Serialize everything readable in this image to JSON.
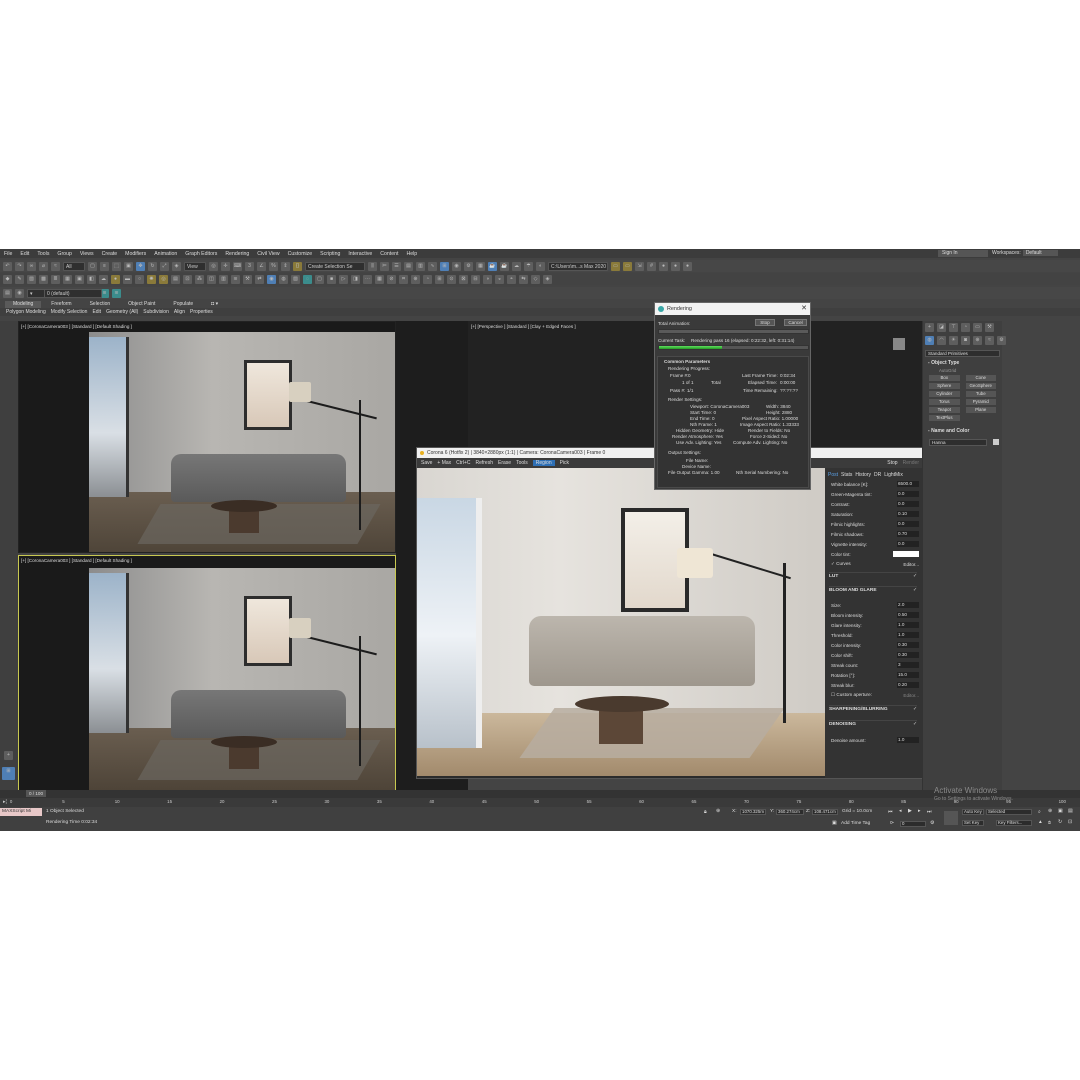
{
  "menu": [
    "File",
    "Edit",
    "Tools",
    "Group",
    "Views",
    "Create",
    "Modifiers",
    "Animation",
    "Graph Editors",
    "Rendering",
    "Civil View",
    "Customize",
    "Scripting",
    "Interactive",
    "Content",
    "Help"
  ],
  "signin": "Sign In",
  "workspace_label": "Workspaces:",
  "workspace_value": "Default",
  "toolbar": {
    "filter": "All",
    "view": "View",
    "selection_set": "Create Selection Se",
    "path": "C:\\Users\\m...s Max 2020"
  },
  "layer_value": "0 (default)",
  "ribbon_tabs": [
    "Modeling",
    "Freeform",
    "Selection",
    "Object Paint",
    "Populate"
  ],
  "ribbon_sub": [
    "Polygon Modeling",
    "Modify Selection",
    "Edit",
    "Geometry (All)",
    "Subdivision",
    "Align",
    "Properties"
  ],
  "viewports": {
    "top_left": "[+] [CoronaCamera003 ] [Standard ] [Default Shading ]",
    "top_right": "[+] [Perspective ] [Standard ] [Clay + Edged Faces ]",
    "bottom_left": "[+] [CoronaCamera003 ] [Standard ] [Default Shading ]"
  },
  "corona": {
    "title": "Corona 6 (Hotfix 2) | 3840×2880px (1:1) | Camera: CoronaCamera003 | Frame 0",
    "tools": [
      "Save",
      "+ Max",
      "Ctrl+C",
      "Refresh",
      "Erase",
      "Tools",
      "Region",
      "Pick"
    ],
    "stop": "Stop",
    "render": "Render",
    "tabs": [
      "Post",
      "Stats",
      "History",
      "DR",
      "LightMix"
    ],
    "rows_top": [
      {
        "label": "White balance [K]:",
        "value": "6500.0"
      },
      {
        "label": "Green-Magenta tint:",
        "value": "0.0"
      },
      {
        "label": "Contrast:",
        "value": "0.0"
      },
      {
        "label": "Saturation:",
        "value": "0.10"
      },
      {
        "label": "Filmic highlights:",
        "value": "0.0"
      },
      {
        "label": "Filmic shadows:",
        "value": "0.70"
      },
      {
        "label": "Vignette intensity:",
        "value": "0.0"
      },
      {
        "label": "Color tint:",
        "value": ""
      }
    ],
    "curves": "Curves",
    "editor": "Editor...",
    "lut": "LUT",
    "bloom": "BLOOM AND GLARE",
    "rows_bloom": [
      {
        "label": "Size:",
        "value": "2.0"
      },
      {
        "label": "Bloom intensity:",
        "value": "0.50"
      },
      {
        "label": "Glare intensity:",
        "value": "1.0"
      },
      {
        "label": "Threshold:",
        "value": "1.0"
      },
      {
        "label": "Color intensity:",
        "value": "0.30"
      },
      {
        "label": "Color shift:",
        "value": "0.30"
      },
      {
        "label": "Streak count:",
        "value": "3"
      },
      {
        "label": "Rotation [°]:",
        "value": "15.0"
      },
      {
        "label": "Streak blur:",
        "value": "0.20"
      }
    ],
    "custom_aperture": "Custom aperture:",
    "editor2": "Editor...",
    "sharpen": "SHARPENING/BLURRING",
    "denoise": "DENOISING",
    "denoise_label": "Denoise amount:",
    "denoise_value": "1.0"
  },
  "rendering": {
    "title": "Rendering",
    "total_animation": "Total Animation:",
    "pause": "Pause",
    "stop": "Stop",
    "cancel": "Cancel",
    "total_progress": 1.0,
    "current_task_label": "Current Task:",
    "current_task": "Rendering pass 16 (elapsed: 0:22:32, left: 0:31:14)",
    "task_progress": 0.42,
    "section": "Common Parameters",
    "progress_label": "Rendering Progress:",
    "frame_label": "Frame #:",
    "frame_value": "0",
    "of_label": "1 of 1",
    "total_label": "Total",
    "pass_label": "Pass #:",
    "pass_value": "1/1",
    "last_frame_label": "Last Frame Time:",
    "last_frame_value": "0:02:34",
    "elapsed_label": "Elapsed Time:",
    "elapsed_value": "0:00:00",
    "remaining_label": "Time Remaining:",
    "remaining_value": "??:??:??",
    "render_settings": "Render Settings:",
    "settings_left": [
      "Viewport: CoronaCamera003",
      "Start Time: 0",
      "End Time: 0",
      "Nth Frame: 1",
      "Hidden Geometry: Hide",
      "Render Atmosphere: Yes",
      "Use Adv. Lighting: Yes"
    ],
    "settings_right": [
      "Width: 3840",
      "Height: 2880",
      "Pixel Aspect Ratio: 1.00000",
      "Image Aspect Ratio: 1.33333",
      "Render to Fields: No",
      "Force 2-Sided: No",
      "Compute Adv. Lighting: No"
    ],
    "output_settings": "Output Settings:",
    "file_name": "File Name:",
    "device_name": "Device Name:",
    "file_gamma": "File Output Gamma: 1.00",
    "nth_serial": "Nth Serial Numbering: No"
  },
  "command_panel": {
    "dropdown": "Standard Primitives",
    "object_type": "Object Type",
    "autogrid": "AutoGrid",
    "buttons": [
      "Box",
      "Cone",
      "Sphere",
      "GeoSphere",
      "Cylinder",
      "Tube",
      "Torus",
      "Pyramid",
      "Teapot",
      "Plane",
      "TextPlus"
    ],
    "name_color": "Name and Color",
    "name_value": "Hanna"
  },
  "timeline": {
    "frame": "0 / 100",
    "ticks": [
      "0",
      "5",
      "10",
      "15",
      "20",
      "25",
      "30",
      "35",
      "40",
      "45",
      "50",
      "55",
      "60",
      "65",
      "70",
      "75",
      "80",
      "85",
      "90",
      "95",
      "100"
    ]
  },
  "status": {
    "maxscript": "MAXScript Mi",
    "selected": "1 Object Selected",
    "render_time": "Rendering Time  0:02:34",
    "x": "1070.325m",
    "y": "360.274cm",
    "z": "108.471cm",
    "grid": "Grid = 10.0cm",
    "add_time_tag": "Add Time Tag",
    "auto_key": "Auto Key",
    "set_key": "Set Key",
    "selected_dd": "Selected",
    "key_filters": "Key Filters...",
    "frame_value": "0"
  },
  "watermark": {
    "title": "Activate Windows",
    "sub": "Go to Settings to activate Windows."
  }
}
